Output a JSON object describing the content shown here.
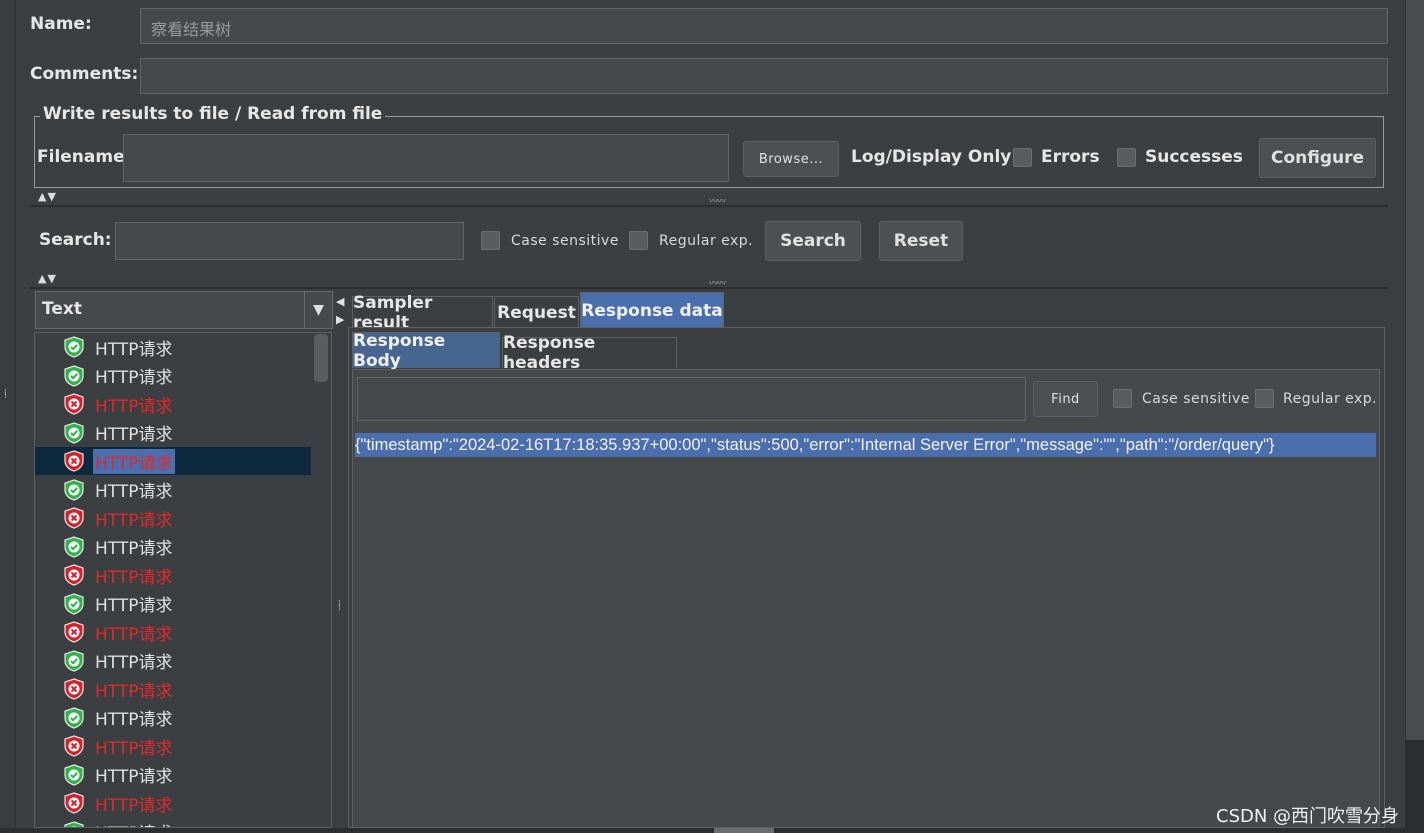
{
  "form": {
    "name_label": "Name:",
    "name_value": "察看结果树",
    "comments_label": "Comments:",
    "comments_value": ""
  },
  "file_section": {
    "legend": "Write results to file / Read from file",
    "filename_label": "Filename",
    "filename_value": "",
    "browse_label": "Browse...",
    "log_display_label": "Log/Display Only:",
    "errors_label": "Errors",
    "successes_label": "Successes",
    "configure_label": "Configure"
  },
  "search_bar": {
    "label": "Search:",
    "value": "",
    "case_sensitive_label": "Case sensitive",
    "regular_exp_label": "Regular exp.",
    "search_button": "Search",
    "reset_button": "Reset"
  },
  "renderer": {
    "selected": "Text"
  },
  "tree": {
    "items": [
      {
        "label": "HTTP请求",
        "status": "success"
      },
      {
        "label": "HTTP请求",
        "status": "success"
      },
      {
        "label": "HTTP请求",
        "status": "error"
      },
      {
        "label": "HTTP请求",
        "status": "success"
      },
      {
        "label": "HTTP请求",
        "status": "error",
        "selected": true
      },
      {
        "label": "HTTP请求",
        "status": "success"
      },
      {
        "label": "HTTP请求",
        "status": "error"
      },
      {
        "label": "HTTP请求",
        "status": "success"
      },
      {
        "label": "HTTP请求",
        "status": "error"
      },
      {
        "label": "HTTP请求",
        "status": "success"
      },
      {
        "label": "HTTP请求",
        "status": "error"
      },
      {
        "label": "HTTP请求",
        "status": "success"
      },
      {
        "label": "HTTP请求",
        "status": "error"
      },
      {
        "label": "HTTP请求",
        "status": "success"
      },
      {
        "label": "HTTP请求",
        "status": "error"
      },
      {
        "label": "HTTP请求",
        "status": "success"
      },
      {
        "label": "HTTP请求",
        "status": "error"
      },
      {
        "label": "HTTP请求",
        "status": "success"
      }
    ]
  },
  "tabs": {
    "main": [
      "Sampler result",
      "Request",
      "Response data"
    ],
    "sub": [
      "Response Body",
      "Response headers"
    ]
  },
  "response": {
    "find_value": "",
    "find_button": "Find",
    "case_sensitive_label": "Case sensitive",
    "regular_exp_label": "Regular exp.",
    "body": "{\"timestamp\":\"2024-02-16T17:18:35.937+00:00\",\"status\":500,\"error\":\"Internal Server Error\",\"message\":\"\",\"path\":\"/order/query\"}"
  },
  "watermark": "CSDN @西门吹雪分身",
  "colors": {
    "background": "#3c3f41",
    "accent": "#4b6eaf",
    "error_text": "#e02a2a",
    "success_icon": "#2fb34a",
    "error_icon": "#d8202a"
  }
}
